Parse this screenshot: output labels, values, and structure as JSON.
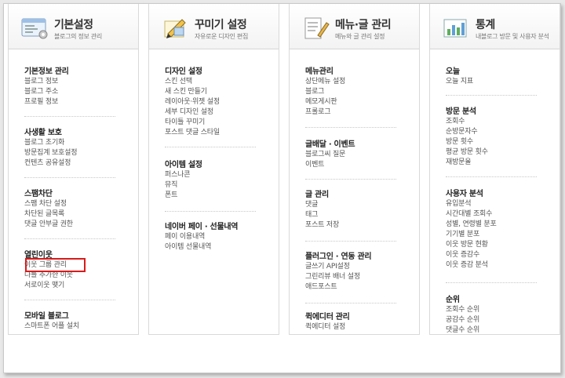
{
  "columns": [
    {
      "title": "기본설정",
      "subtitle": "블로그의 정보 관리",
      "icon": "settings-window-icon",
      "sections": [
        {
          "heading": "기본정보 관리",
          "items": [
            "블로그 정보",
            "블로그 주소",
            "프로필 정보"
          ]
        },
        {
          "heading": "사생활 보호",
          "items": [
            "블로그 초기화",
            "방문집계 보호설정",
            "컨텐츠 공유설정"
          ]
        },
        {
          "heading": "스팸차단",
          "items": [
            "스팸 차단 설정",
            "차단된 글목록",
            "댓글 안부글 권한"
          ]
        },
        {
          "heading": "열린이웃",
          "items": [
            "이웃 그룹 관리",
            "나를 추가한 이웃",
            "서로이웃 맺기"
          ]
        },
        {
          "heading": "모바일 블로그",
          "items": [
            "스마트폰 어플 설치"
          ]
        }
      ]
    },
    {
      "title": "꾸미기 설정",
      "subtitle": "자유로운 디자인 편집",
      "icon": "design-pen-icon",
      "sections": [
        {
          "heading": "디자인 설정",
          "items": [
            "스킨 선택",
            "새 스킨 만들기",
            "레이아웃·위젯 설정",
            "세부 디자인 설정",
            "타이틀 꾸미기",
            "포스트 댓글 스타일"
          ]
        },
        {
          "heading": "아이템 설정",
          "items": [
            "퍼스나콘",
            "뮤직",
            "폰트"
          ]
        },
        {
          "heading": "네이버 페이 · 선물내역",
          "items": [
            "페이 이용내역",
            "아이템 선물내역"
          ]
        }
      ]
    },
    {
      "title": "메뉴·글 관리",
      "subtitle": "메뉴와 글 관리 설정",
      "icon": "document-pencil-icon",
      "sections": [
        {
          "heading": "메뉴관리",
          "items": [
            "상단메뉴 설정",
            "블로그",
            "메모게시판",
            "프롤로그"
          ]
        },
        {
          "heading": "글배달 · 이벤트",
          "items": [
            "블로그씨 질문",
            "이벤트"
          ]
        },
        {
          "heading": "글 관리",
          "items": [
            "댓글",
            "태그",
            "포스트 저장"
          ]
        },
        {
          "heading": "플러그인 · 연동 관리",
          "items": [
            "글쓰기 API설정",
            "그린리뷰 배너 설정",
            "애드포스트"
          ]
        },
        {
          "heading": "퀵에디터 관리",
          "items": [
            "퀵에디터 설정"
          ]
        }
      ]
    },
    {
      "title": "통계",
      "subtitle": "내블로그 방문 및 사용자 분석",
      "icon": "statistics-chart-icon",
      "sections": [
        {
          "heading": "오늘",
          "items": [
            "오늘 지표"
          ]
        },
        {
          "heading": "방문 분석",
          "items": [
            "조회수",
            "순방문자수",
            "방문 횟수",
            "평균 방문 횟수",
            "재방문율"
          ]
        },
        {
          "heading": "사용자 분석",
          "items": [
            "유입분석",
            "시간대별 조회수",
            "성별, 연령별 분포",
            "기기별 분포",
            "이웃 방문 현황",
            "이웃 증감수",
            "이웃 증감 분석"
          ]
        },
        {
          "heading": "순위",
          "items": [
            "조회수 순위",
            "공감수 순위",
            "댓글수 순위"
          ]
        }
      ]
    }
  ]
}
